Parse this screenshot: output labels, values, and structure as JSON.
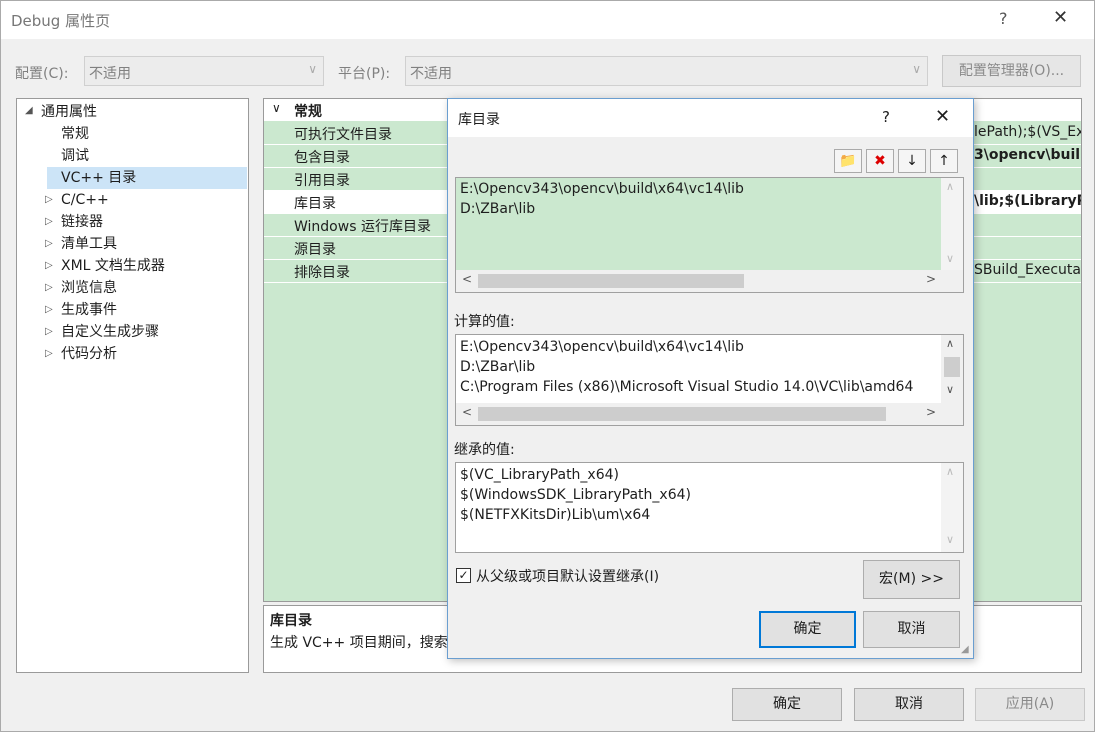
{
  "window": {
    "title": "Debug 属性页",
    "help": "?",
    "close": "✕"
  },
  "config_bar": {
    "config_label": "配置(C):",
    "config_value": "不适用",
    "platform_label": "平台(P):",
    "platform_value": "不适用",
    "manager_button": "配置管理器(O)..."
  },
  "tree": {
    "root": "通用属性",
    "items": [
      {
        "label": "常规"
      },
      {
        "label": "调试"
      },
      {
        "label": "VC++ 目录"
      }
    ],
    "groups": [
      {
        "label": "C/C++"
      },
      {
        "label": "链接器"
      },
      {
        "label": "清单工具"
      },
      {
        "label": "XML 文档生成器"
      },
      {
        "label": "浏览信息"
      },
      {
        "label": "生成事件"
      },
      {
        "label": "自定义生成步骤"
      },
      {
        "label": "代码分析"
      }
    ]
  },
  "grid": {
    "section": "常规",
    "rows": [
      {
        "name": "可执行文件目录",
        "value": "lePath);$(VS_Ex"
      },
      {
        "name": "包含目录",
        "value": "3\\opencv\\buil"
      },
      {
        "name": "引用目录",
        "value": ""
      },
      {
        "name": "库目录",
        "value": "\\lib;$(LibraryPa"
      },
      {
        "name": "Windows 运行库目录",
        "value": ""
      },
      {
        "name": "源目录",
        "value": ""
      },
      {
        "name": "排除目录",
        "value": "SBuild_Executa"
      }
    ]
  },
  "description": {
    "title": "库目录",
    "text": "生成 VC++ 项目期间，搜索"
  },
  "footer": {
    "ok": "确定",
    "cancel": "取消",
    "apply": "应用(A)"
  },
  "dialog": {
    "title": "库目录",
    "help": "?",
    "close": "✕",
    "toolbar": {
      "new_folder": "📁",
      "delete": "✖",
      "move_down": "↓",
      "move_up": "↑"
    },
    "entries": [
      "E:\\Opencv343\\opencv\\build\\x64\\vc14\\lib",
      "D:\\ZBar\\lib"
    ],
    "computed_label": "计算的值:",
    "computed": [
      "E:\\Opencv343\\opencv\\build\\x64\\vc14\\lib",
      "D:\\ZBar\\lib",
      "C:\\Program Files (x86)\\Microsoft Visual Studio 14.0\\VC\\lib\\amd64"
    ],
    "inherited_label": "继承的值:",
    "inherited": [
      "$(VC_LibraryPath_x64)",
      "$(WindowsSDK_LibraryPath_x64)",
      "$(NETFXKitsDir)Lib\\um\\x64"
    ],
    "inherit_checkbox": "从父级或项目默认设置继承(I)",
    "inherit_checked": true,
    "macro_button": "宏(M) >>",
    "ok": "确定",
    "cancel": "取消"
  }
}
